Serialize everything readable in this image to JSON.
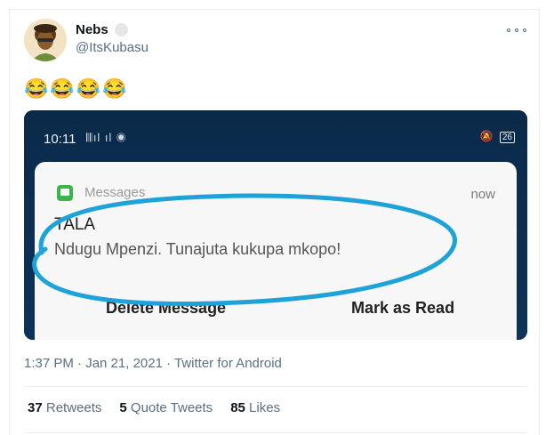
{
  "tweet": {
    "author_name": "Nebs",
    "author_handle": "@ItsKubasu",
    "text": "😂😂😂😂",
    "timestamp": "1:37 PM · Jan 21, 2021",
    "separator": " · ",
    "source": "Twitter for Android"
  },
  "media": {
    "status_time": "10:11",
    "status_icons": "𝄃𝄃ıl ıl ◉",
    "battery": "26",
    "notification": {
      "app_name": "Messages",
      "time": "now",
      "sender": "TALA",
      "body": "Ndugu Mpenzi. Tunajuta kukupa mkopo!",
      "delete_label": "Delete Message",
      "read_label": "Mark as Read"
    },
    "annotation_color": "#1ea3d8"
  },
  "stats": {
    "retweets_count": "37",
    "retweets_label": "Retweets",
    "quotes_count": "5",
    "quotes_label": "Quote Tweets",
    "likes_count": "85",
    "likes_label": "Likes"
  },
  "colors": {
    "secondary_text": "#5b7083",
    "media_bg": "#0c3052",
    "app_icon": "#3bb54a"
  },
  "icons": {
    "avatar": "avatar",
    "more": "more-icon",
    "app": "messages-app-icon",
    "verified": "verified-badge-icon"
  }
}
